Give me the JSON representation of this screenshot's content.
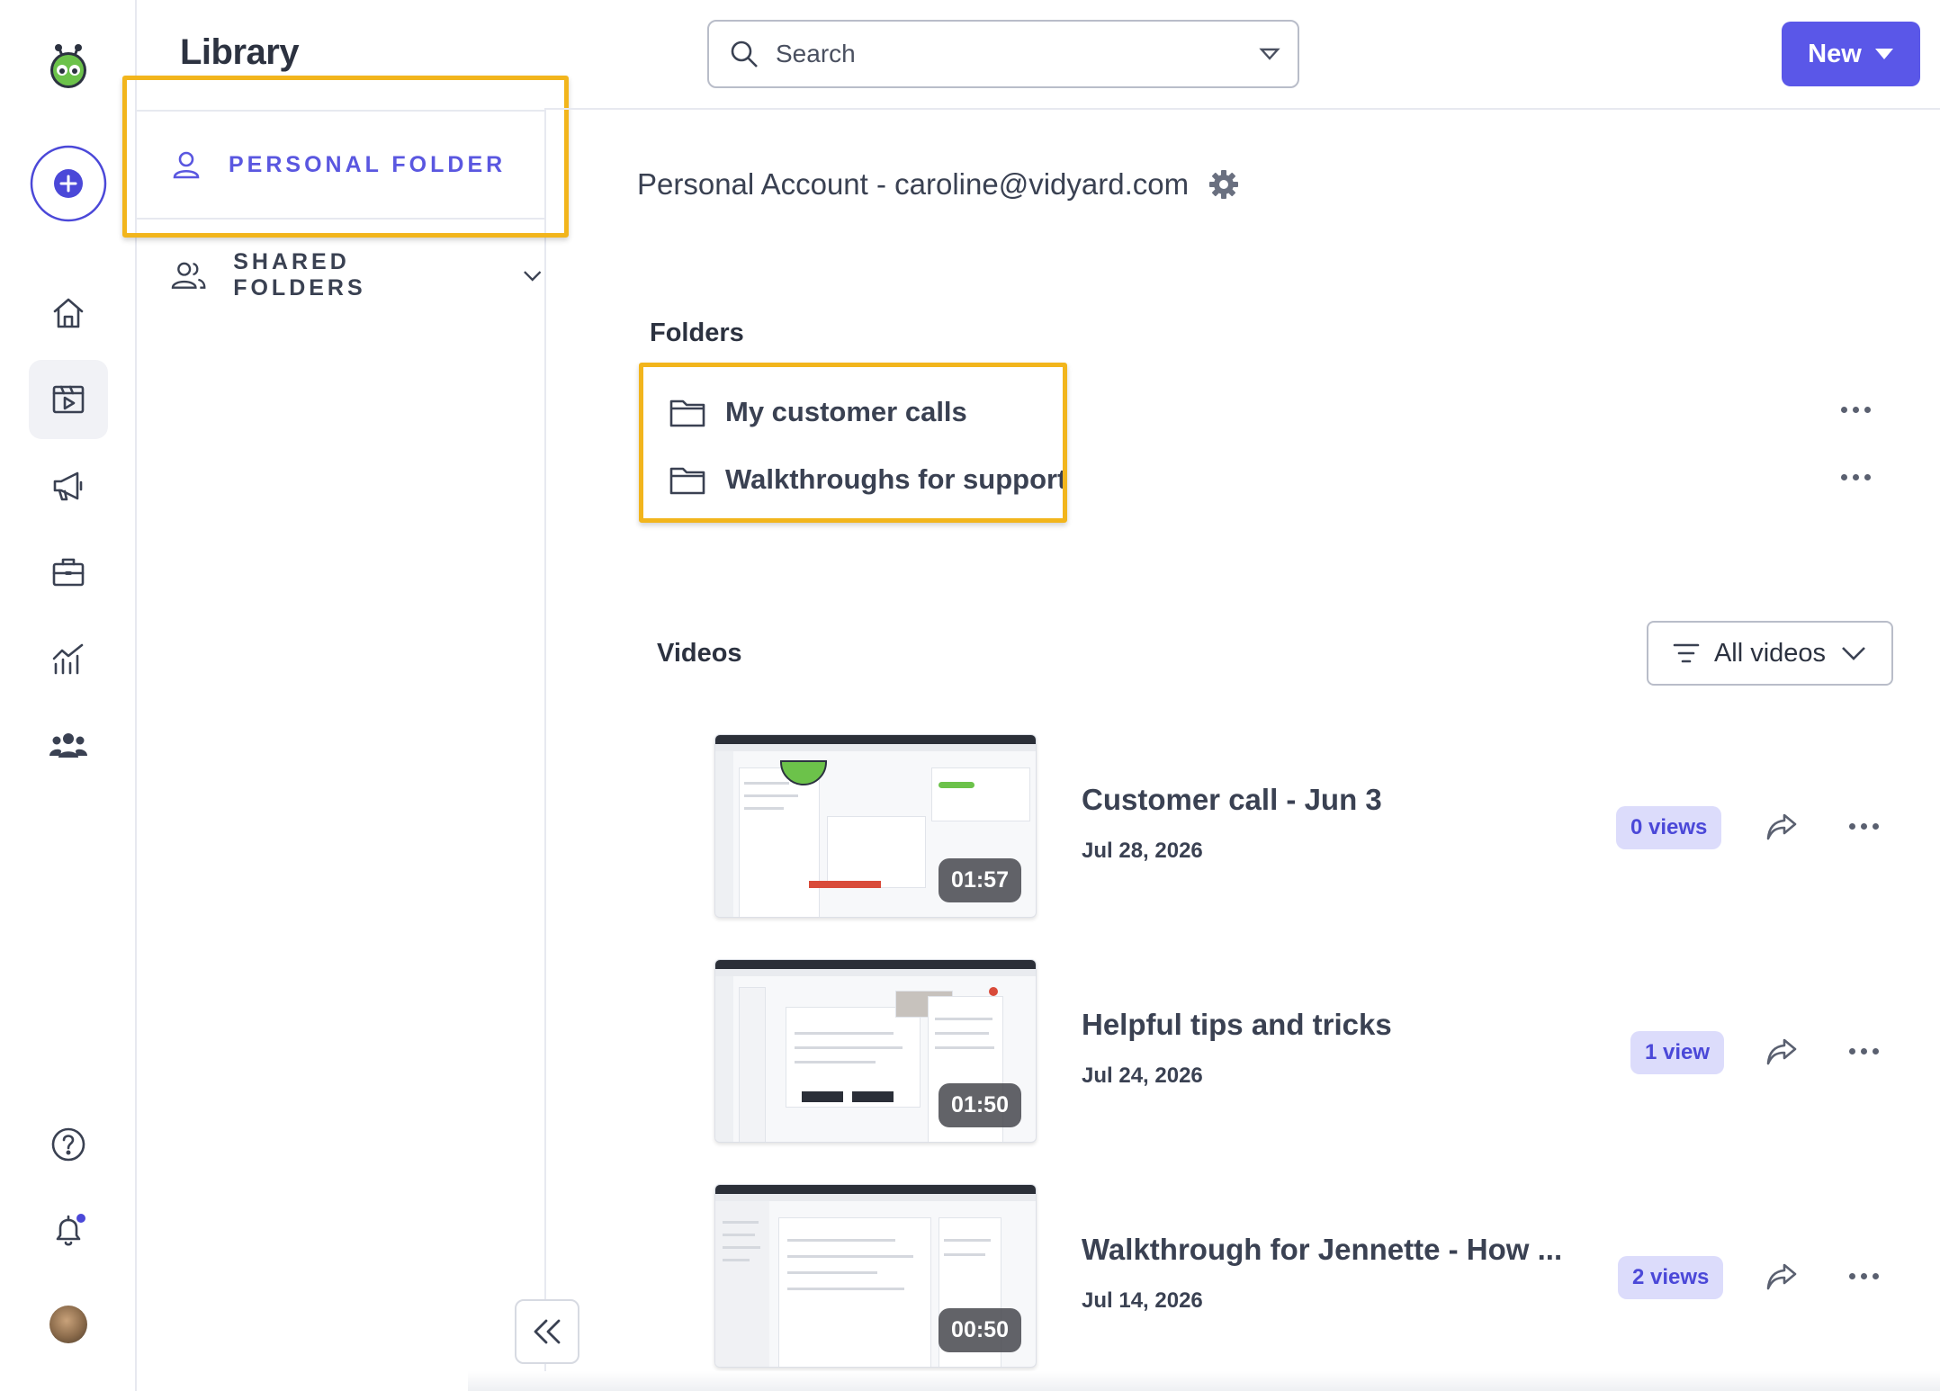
{
  "app": {
    "title": "Library"
  },
  "sidebar": {
    "personal_folder": "PERSONAL FOLDER",
    "shared_folders": "SHARED FOLDERS"
  },
  "search": {
    "placeholder": "Search"
  },
  "toolbar": {
    "new_label": "New"
  },
  "account": {
    "label": "Personal Account - caroline@vidyard.com"
  },
  "folders": {
    "title": "Folders",
    "items": [
      {
        "name": "My customer calls"
      },
      {
        "name": "Walkthroughs for support"
      }
    ]
  },
  "videos": {
    "title": "Videos",
    "filter_label": "All videos",
    "items": [
      {
        "title": "Customer call - Jun 3",
        "date": "Jul 28, 2026",
        "views": "0 views",
        "duration": "01:57"
      },
      {
        "title": "Helpful tips and tricks",
        "date": "Jul 24, 2026",
        "views": "1 view",
        "duration": "01:50"
      },
      {
        "title": "Walkthrough for Jennette - How ...",
        "date": "Jul 14, 2026",
        "views": "2 views",
        "duration": "00:50"
      }
    ]
  },
  "colors": {
    "accent": "#5a57e8",
    "highlight": "#f2b51c",
    "views_badge_bg": "#dcdcfb"
  },
  "icons": {
    "rail": [
      "vidyard-logo-icon",
      "add-circle-icon",
      "home-icon",
      "library-icon",
      "megaphone-icon",
      "briefcase-icon",
      "analytics-icon",
      "team-icon",
      "help-icon",
      "bell-icon"
    ]
  }
}
